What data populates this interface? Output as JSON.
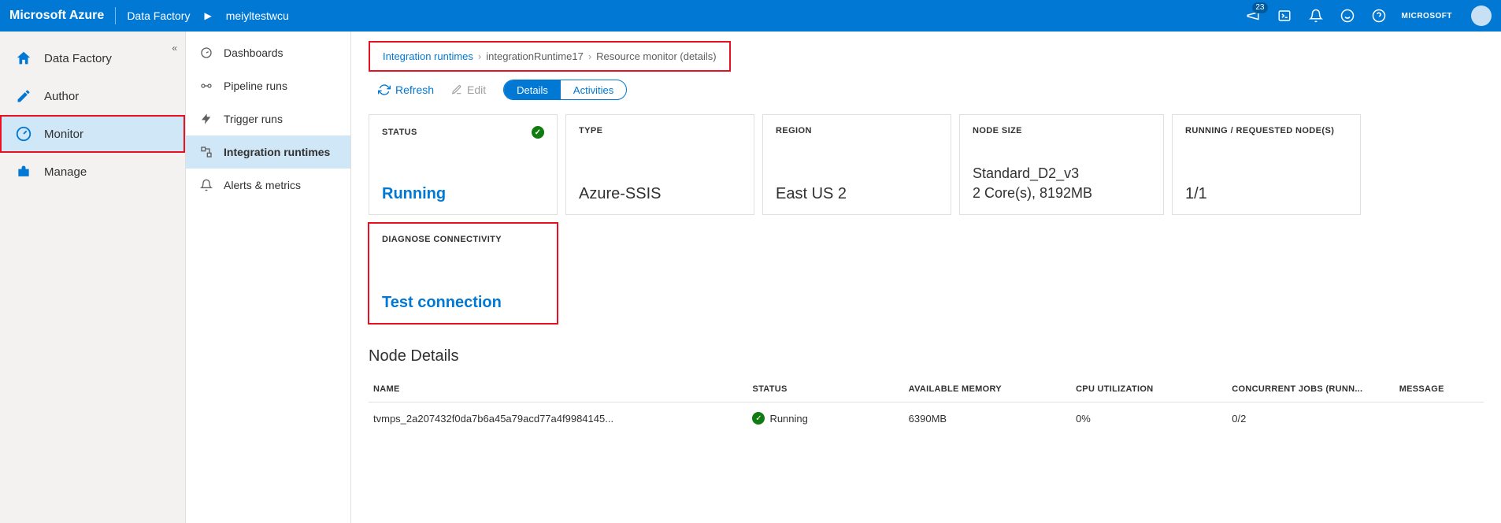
{
  "topbar": {
    "brand": "Microsoft Azure",
    "service": "Data Factory",
    "resource": "meiyltestwcu",
    "notification_count": "23",
    "tenant": "MICROSOFT"
  },
  "nav1": {
    "items": [
      {
        "label": "Data Factory",
        "icon": "home"
      },
      {
        "label": "Author",
        "icon": "pencil"
      },
      {
        "label": "Monitor",
        "icon": "gauge",
        "active": true
      },
      {
        "label": "Manage",
        "icon": "toolbox"
      }
    ]
  },
  "nav2": {
    "items": [
      {
        "label": "Dashboards",
        "icon": "speed"
      },
      {
        "label": "Pipeline runs",
        "icon": "pipeline"
      },
      {
        "label": "Trigger runs",
        "icon": "bolt"
      },
      {
        "label": "Integration runtimes",
        "icon": "ir",
        "active": true
      },
      {
        "label": "Alerts & metrics",
        "icon": "bell"
      }
    ]
  },
  "breadcrumb": {
    "a": "Integration runtimes",
    "b": "integrationRuntime17",
    "c": "Resource monitor (details)"
  },
  "cmdbar": {
    "refresh": "Refresh",
    "edit": "Edit",
    "details": "Details",
    "activities": "Activities"
  },
  "cards": {
    "status": {
      "title": "STATUS",
      "value": "Running"
    },
    "type": {
      "title": "TYPE",
      "value": "Azure-SSIS"
    },
    "region": {
      "title": "REGION",
      "value": "East US 2"
    },
    "nodesize": {
      "title": "NODE SIZE",
      "line1": "Standard_D2_v3",
      "line2": "2 Core(s), 8192MB"
    },
    "nodes": {
      "title": "RUNNING / REQUESTED NODE(S)",
      "value": "1/1"
    },
    "diag": {
      "title": "DIAGNOSE CONNECTIVITY",
      "value": "Test connection"
    }
  },
  "node_details": {
    "title": "Node Details",
    "headers": {
      "name": "NAME",
      "status": "STATUS",
      "mem": "AVAILABLE MEMORY",
      "cpu": "CPU UTILIZATION",
      "jobs": "CONCURRENT JOBS (RUNN...",
      "msg": "MESSAGE"
    },
    "rows": [
      {
        "name": "tvmps_2a207432f0da7b6a45a79acd77a4f9984145...",
        "status": "Running",
        "mem": "6390MB",
        "cpu": "0%",
        "jobs": "0/2",
        "msg": ""
      }
    ]
  }
}
